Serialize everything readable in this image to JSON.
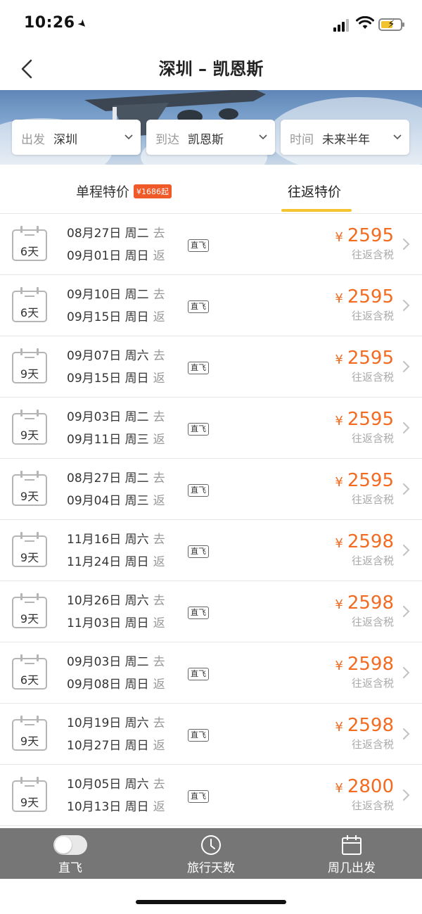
{
  "status_bar": {
    "time": "10:26"
  },
  "nav": {
    "title": "深圳 – 凯恩斯",
    "back_icon": "chevron-left-icon"
  },
  "filters": {
    "depart": {
      "label": "出发",
      "value": "深圳"
    },
    "arrive": {
      "label": "到达",
      "value": "凯恩斯"
    },
    "time": {
      "label": "时间",
      "value": "未来半年"
    }
  },
  "tabs": {
    "oneway": {
      "label": "单程特价",
      "badge": "¥1686起"
    },
    "roundtrip": {
      "label": "往返特价",
      "active": true
    }
  },
  "currency": "¥",
  "fares": [
    {
      "days": "6天",
      "out": "08月27日 周二",
      "out_tag": "去",
      "ret": "09月01日 周日",
      "ret_tag": "返",
      "direct": "直飞",
      "price": "2595",
      "note": "往返含税"
    },
    {
      "days": "6天",
      "out": "09月10日 周二",
      "out_tag": "去",
      "ret": "09月15日 周日",
      "ret_tag": "返",
      "direct": "直飞",
      "price": "2595",
      "note": "往返含税"
    },
    {
      "days": "9天",
      "out": "09月07日 周六",
      "out_tag": "去",
      "ret": "09月15日 周日",
      "ret_tag": "返",
      "direct": "直飞",
      "price": "2595",
      "note": "往返含税"
    },
    {
      "days": "9天",
      "out": "09月03日 周二",
      "out_tag": "去",
      "ret": "09月11日 周三",
      "ret_tag": "返",
      "direct": "直飞",
      "price": "2595",
      "note": "往返含税"
    },
    {
      "days": "9天",
      "out": "08月27日 周二",
      "out_tag": "去",
      "ret": "09月04日 周三",
      "ret_tag": "返",
      "direct": "直飞",
      "price": "2595",
      "note": "往返含税"
    },
    {
      "days": "9天",
      "out": "11月16日 周六",
      "out_tag": "去",
      "ret": "11月24日 周日",
      "ret_tag": "返",
      "direct": "直飞",
      "price": "2598",
      "note": "往返含税"
    },
    {
      "days": "9天",
      "out": "10月26日 周六",
      "out_tag": "去",
      "ret": "11月03日 周日",
      "ret_tag": "返",
      "direct": "直飞",
      "price": "2598",
      "note": "往返含税"
    },
    {
      "days": "6天",
      "out": "09月03日 周二",
      "out_tag": "去",
      "ret": "09月08日 周日",
      "ret_tag": "返",
      "direct": "直飞",
      "price": "2598",
      "note": "往返含税"
    },
    {
      "days": "9天",
      "out": "10月19日 周六",
      "out_tag": "去",
      "ret": "10月27日 周日",
      "ret_tag": "返",
      "direct": "直飞",
      "price": "2598",
      "note": "往返含税"
    },
    {
      "days": "9天",
      "out": "10月05日 周六",
      "out_tag": "去",
      "ret": "10月13日 周日",
      "ret_tag": "返",
      "direct": "直飞",
      "price": "2800",
      "note": "往返含税"
    }
  ],
  "bottom_bar": {
    "direct": {
      "label": "直飞",
      "icon": "toggle-switch-icon"
    },
    "duration": {
      "label": "旅行天数",
      "icon": "clock-icon"
    },
    "weekday": {
      "label": "周几出发",
      "icon": "calendar-icon"
    }
  },
  "colors": {
    "accent": "#f26b21",
    "tab_underline": "#f5c531",
    "bottom_bar": "#767676"
  }
}
